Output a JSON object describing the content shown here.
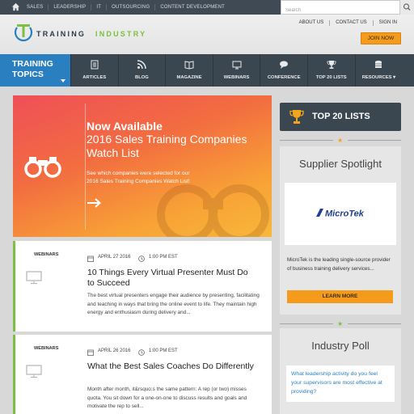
{
  "topbar": {
    "nav": [
      "SALES",
      "LEADERSHIP",
      "IT",
      "OUTSOURCING",
      "CONTENT DEVELOPMENT"
    ],
    "search_placeholder": "Search"
  },
  "header": {
    "logo_word_1": "TRAINING",
    "logo_word_2": "INDUSTRY",
    "util": [
      "ABOUT US",
      "CONTACT US",
      "SIGN IN"
    ],
    "join_label": "JOIN NOW"
  },
  "mainnav": {
    "topics_label_1": "TRAINING",
    "topics_label_2": "TOPICS",
    "items": [
      {
        "label": "ARTICLES",
        "icon": "articles-icon"
      },
      {
        "label": "BLOG",
        "icon": "rss-icon"
      },
      {
        "label": "MAGAZINE",
        "icon": "book-icon"
      },
      {
        "label": "WEBINARS",
        "icon": "monitor-icon"
      },
      {
        "label": "CONFERENCE",
        "icon": "chat-icon"
      },
      {
        "label": "TOP 20 LISTS",
        "icon": "trophy-icon"
      },
      {
        "label": "RESOURCES ▾",
        "icon": "database-icon"
      }
    ]
  },
  "hero": {
    "heading": "Now Available",
    "subheading": "2016 Sales Training Companies Watch List",
    "text": "See which companies were selected for our 2016 Sales Training Companies Watch List!"
  },
  "articles": [
    {
      "category": "WEBINARS",
      "date": "APRIL 27 2016",
      "time": "1:00 PM EST",
      "title": "10 Things Every Virtual Presenter Must Do to Succeed",
      "excerpt": "The best virtual presenters engage their audience by presenting, facilitating and teaching in ways that bring the online event to life. They maintain high energy and enthusiasm during delivery and..."
    },
    {
      "category": "WEBINARS",
      "date": "APRIL 26 2016",
      "time": "1:00 PM EST",
      "title": "What the Best Sales Coaches Do Differently",
      "excerpt": "Month after month, it&rsquo;s the same pattern: A rep (or two) misses quota. You sit down for a one-on-one to discuss results and goals and motivate the rep to sell..."
    }
  ],
  "sidebar": {
    "top20_label": "TOP 20 LISTS",
    "supplier_heading": "Supplier Spotlight",
    "supplier_logo_text": "MicroTek",
    "supplier_desc": "MicroTek is the leading single-source provider of business training delivery services...",
    "learn_more": "LEARN MORE",
    "poll_heading": "Industry Poll",
    "poll_question": "What leadership activity do you feel your supervisors are most effective at providing?"
  },
  "colors": {
    "nav_dark": "#3a4650",
    "accent_blue": "#2a7fc1",
    "accent_orange": "#f49b1c",
    "accent_green": "#7ac143"
  }
}
